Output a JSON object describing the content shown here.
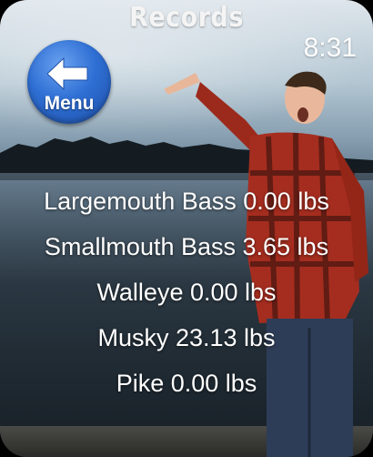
{
  "header": {
    "title": "Records",
    "time": "8:31"
  },
  "menu_button": {
    "label": "Menu",
    "icon": "back-arrow-icon"
  },
  "records": [
    {
      "label": "Largemouth Bass 0.00 lbs"
    },
    {
      "label": "Smallmouth Bass 3.65 lbs"
    },
    {
      "label": "Walleye 0.00 lbs"
    },
    {
      "label": "Musky 23.13 lbs"
    },
    {
      "label": "Pike 0.00 lbs"
    }
  ],
  "colors": {
    "button_blue": "#2f6fd4",
    "text": "#ffffff"
  }
}
